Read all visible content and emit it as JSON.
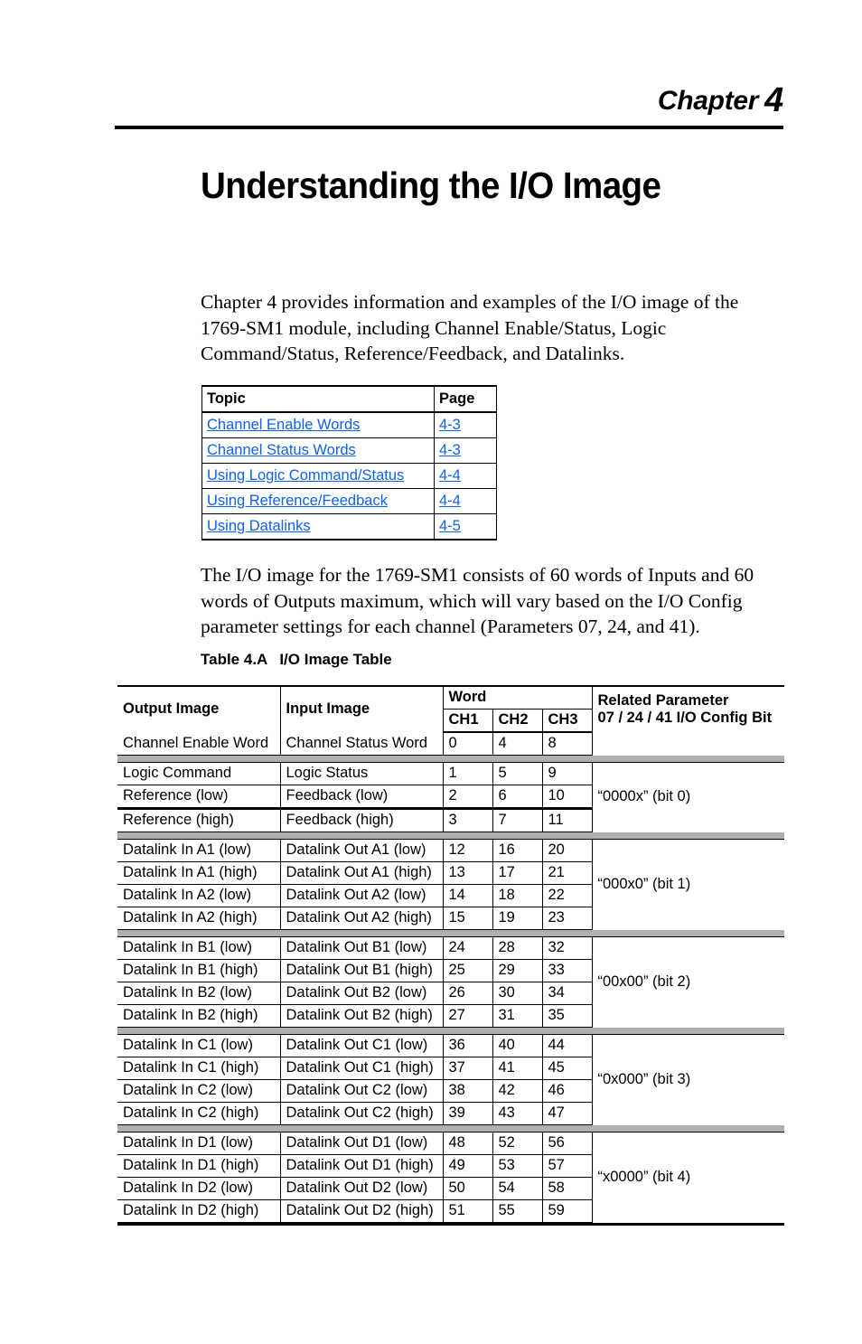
{
  "header": {
    "chapter_word": "Chapter",
    "chapter_number": "4"
  },
  "title": "Understanding the I/O Image",
  "paragraphs": {
    "intro": "Chapter 4 provides information and examples of the I/O image of the 1769-SM1 module, including Channel Enable/Status, Logic Command/Status, Reference/Feedback, and Datalinks.",
    "second": "The I/O image for the 1769-SM1 consists of 60 words of Inputs and 60 words of Outputs maximum, which will vary based on the I/O Config parameter settings for each channel (Parameters 07, 24, and 41)."
  },
  "topic_table": {
    "headers": {
      "topic": "Topic",
      "page": "Page"
    },
    "link_color": "#0f62ea",
    "rows": [
      {
        "topic": "Channel Enable Words",
        "page": "4-3"
      },
      {
        "topic": "Channel Status Words",
        "page": "4-3"
      },
      {
        "topic": "Using Logic Command/Status",
        "page": "4-4"
      },
      {
        "topic": "Using Reference/Feedback",
        "page": "4-4"
      },
      {
        "topic": "Using Datalinks",
        "page": "4-5"
      }
    ]
  },
  "io_table": {
    "caption_label": "Table 4.A",
    "caption_title": "I/O Image Table",
    "headers": {
      "output_image": "Output Image",
      "input_image": "Input Image",
      "word": "Word",
      "ch1": "CH1",
      "ch2": "CH2",
      "ch3": "CH3",
      "related_parameter_line1": "Related Parameter",
      "related_parameter_line2": "07 / 24 / 41 I/O Config Bit"
    },
    "groups": [
      {
        "parameter": "",
        "rows": [
          {
            "output": "Channel Enable Word",
            "input": "Channel Status Word",
            "ch1": "0",
            "ch2": "4",
            "ch3": "8"
          }
        ]
      },
      {
        "parameter": "“0000x” (bit 0)",
        "rows": [
          {
            "output": "Logic Command",
            "input": "Logic Status",
            "ch1": "1",
            "ch2": "5",
            "ch3": "9"
          },
          {
            "output": "Reference (low)",
            "input": "Feedback (low)",
            "ch1": "2",
            "ch2": "6",
            "ch3": "10"
          },
          {
            "output": "Reference (high)",
            "input": "Feedback (high)",
            "ch1": "3",
            "ch2": "7",
            "ch3": "11"
          }
        ]
      },
      {
        "parameter": "“000x0” (bit 1)",
        "rows": [
          {
            "output": "Datalink In A1 (low)",
            "input": "Datalink Out A1 (low)",
            "ch1": "12",
            "ch2": "16",
            "ch3": "20"
          },
          {
            "output": "Datalink In A1 (high)",
            "input": "Datalink Out A1 (high)",
            "ch1": "13",
            "ch2": "17",
            "ch3": "21"
          },
          {
            "output": "Datalink In A2 (low)",
            "input": "Datalink Out A2 (low)",
            "ch1": "14",
            "ch2": "18",
            "ch3": "22"
          },
          {
            "output": "Datalink In A2 (high)",
            "input": "Datalink Out A2 (high)",
            "ch1": "15",
            "ch2": "19",
            "ch3": "23"
          }
        ]
      },
      {
        "parameter": "“00x00” (bit 2)",
        "rows": [
          {
            "output": "Datalink In B1 (low)",
            "input": "Datalink Out B1 (low)",
            "ch1": "24",
            "ch2": "28",
            "ch3": "32"
          },
          {
            "output": "Datalink In B1 (high)",
            "input": "Datalink Out B1 (high)",
            "ch1": "25",
            "ch2": "29",
            "ch3": "33"
          },
          {
            "output": "Datalink In B2 (low)",
            "input": "Datalink Out B2 (low)",
            "ch1": "26",
            "ch2": "30",
            "ch3": "34"
          },
          {
            "output": "Datalink In B2 (high)",
            "input": "Datalink Out B2 (high)",
            "ch1": "27",
            "ch2": "31",
            "ch3": "35"
          }
        ]
      },
      {
        "parameter": "“0x000” (bit 3)",
        "rows": [
          {
            "output": "Datalink In C1 (low)",
            "input": "Datalink Out C1 (low)",
            "ch1": "36",
            "ch2": "40",
            "ch3": "44"
          },
          {
            "output": "Datalink In C1 (high)",
            "input": "Datalink Out C1 (high)",
            "ch1": "37",
            "ch2": "41",
            "ch3": "45"
          },
          {
            "output": "Datalink In C2 (low)",
            "input": "Datalink Out C2 (low)",
            "ch1": "38",
            "ch2": "42",
            "ch3": "46"
          },
          {
            "output": "Datalink In C2 (high)",
            "input": "Datalink Out C2 (high)",
            "ch1": "39",
            "ch2": "43",
            "ch3": "47"
          }
        ]
      },
      {
        "parameter": "“x0000” (bit 4)",
        "rows": [
          {
            "output": "Datalink In D1 (low)",
            "input": "Datalink Out D1 (low)",
            "ch1": "48",
            "ch2": "52",
            "ch3": "56"
          },
          {
            "output": "Datalink In D1 (high)",
            "input": "Datalink Out D1 (high)",
            "ch1": "49",
            "ch2": "53",
            "ch3": "57"
          },
          {
            "output": "Datalink In D2 (low)",
            "input": "Datalink Out D2 (low)",
            "ch1": "50",
            "ch2": "54",
            "ch3": "58"
          },
          {
            "output": "Datalink In D2 (high)",
            "input": "Datalink Out D2 (high)",
            "ch1": "51",
            "ch2": "55",
            "ch3": "59"
          }
        ]
      }
    ]
  }
}
